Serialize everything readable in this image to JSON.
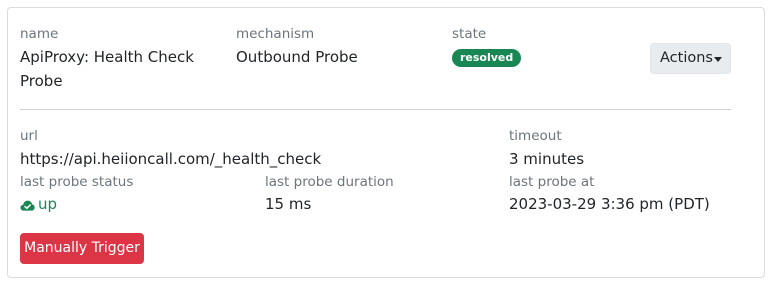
{
  "header": {
    "name_label": "name",
    "name_value_line1": "ApiProxy: Health Check",
    "name_value_line2": "Probe",
    "mechanism_label": "mechanism",
    "mechanism_value": "Outbound Probe",
    "state_label": "state",
    "state_badge": "resolved",
    "actions_label": "Actions"
  },
  "details": {
    "url_label": "url",
    "url_value": "https://api.heiioncall.com/_health_check",
    "timeout_label": "timeout",
    "timeout_value": "3 minutes",
    "last_status_label": "last probe status",
    "last_status_value": "up",
    "last_duration_label": "last probe duration",
    "last_duration_value": "15 ms",
    "last_at_label": "last probe at",
    "last_at_value": "2023-03-29 3:36 pm (PDT)"
  },
  "trigger_button_label": "Manually Trigger",
  "colors": {
    "success": "#198754",
    "danger": "#dc3545",
    "muted": "#6c757d",
    "button_secondary": "#e9ecef"
  },
  "icons": {
    "status": "cloud-check-icon",
    "actions": "caret-down-icon"
  }
}
